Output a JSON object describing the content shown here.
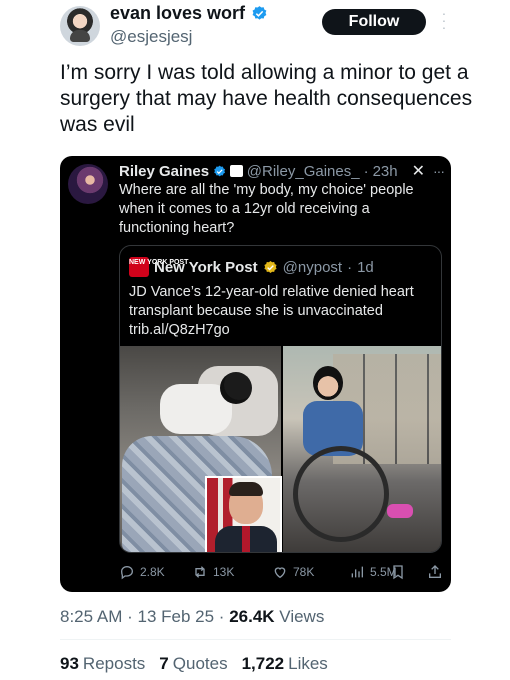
{
  "author": {
    "display_name": "evan loves worf",
    "handle": "@esjesjesj",
    "follow_label": "Follow"
  },
  "tweet": {
    "text": "I’m sorry I was told allowing a minor to get a surgery that may have health consequences was evil",
    "time": "8:25 AM",
    "date": "13 Feb 25",
    "views_count": "26.4K",
    "views_label": "Views"
  },
  "embedded": {
    "name": "Riley Gaines",
    "handle": "@Riley_Gaines_",
    "time": "23h",
    "text": "Where are all the 'my body, my choice' people when it comes to a 12yr old receiving a functioning heart?",
    "quote": {
      "name": "New York Post",
      "handle": "@nypost",
      "time": "1d",
      "logo_text": "NEW YORK POST",
      "text": "JD Vance’s 12-year-old relative denied heart transplant because she is unvaccinated trib.al/Q8zH7go"
    },
    "actions": {
      "replies": "2.8K",
      "reposts": "13K",
      "likes": "78K",
      "views": "5.5M"
    }
  },
  "engagement": {
    "reposts_count": "93",
    "reposts_label": "Reposts",
    "quotes_count": "7",
    "quotes_label": "Quotes",
    "likes_count": "1,722",
    "likes_label": "Likes"
  },
  "colors": {
    "verified_blue": "#1d9bf0",
    "verified_gold": "#e2b719",
    "card_bg": "#000000",
    "secondary_text": "#536471"
  }
}
